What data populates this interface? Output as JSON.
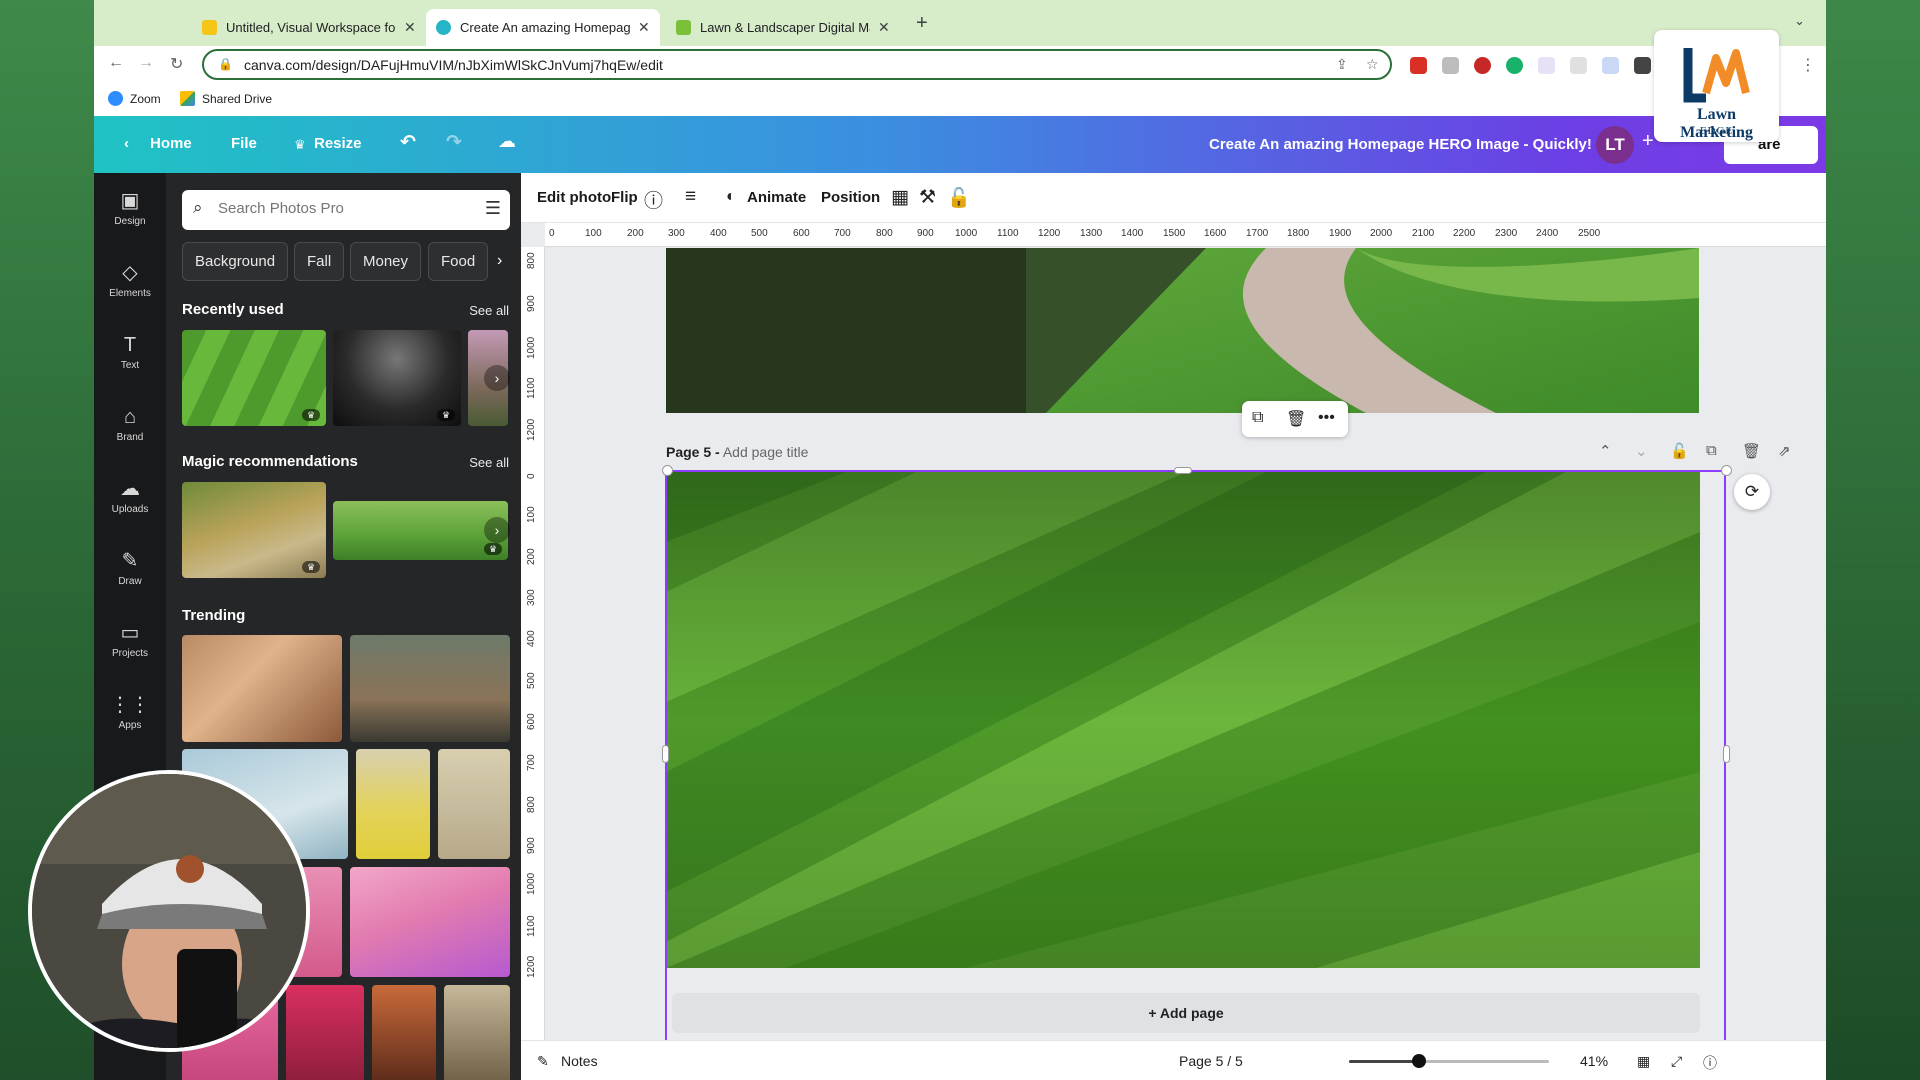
{
  "browser": {
    "tabs": [
      {
        "title": "Untitled, Visual Workspace for",
        "active": false
      },
      {
        "title": "Create An amazing Homepage",
        "active": true
      },
      {
        "title": "Lawn & Landscaper Digital Ma",
        "active": false
      }
    ],
    "url": "canva.com/design/DAFujHmuVIM/nJbXimWlSkCJnVumj7hqEw/edit",
    "bookmarks": [
      {
        "label": "Zoom"
      },
      {
        "label": "Shared Drive"
      }
    ]
  },
  "header": {
    "home": "Home",
    "file": "File",
    "resize": "Resize",
    "doc_title": "Create An amazing Homepage HERO Image - Quickly!",
    "avatar": "LT",
    "share": "are"
  },
  "logo": {
    "line1": "Lawn Marketing",
    "line2": "EDGE"
  },
  "rail": {
    "items": [
      {
        "label": "Design",
        "icon": "design-icon",
        "glyph": "▣"
      },
      {
        "label": "Elements",
        "icon": "elements-icon",
        "glyph": "◇"
      },
      {
        "label": "Text",
        "icon": "text-icon",
        "glyph": "T"
      },
      {
        "label": "Brand",
        "icon": "brand-icon",
        "glyph": "⌂"
      },
      {
        "label": "Uploads",
        "icon": "uploads-icon",
        "glyph": "☁"
      },
      {
        "label": "Draw",
        "icon": "draw-icon",
        "glyph": "✎"
      },
      {
        "label": "Projects",
        "icon": "projects-icon",
        "glyph": "▭"
      },
      {
        "label": "Apps",
        "icon": "apps-icon",
        "glyph": "⋮⋮"
      }
    ]
  },
  "panel": {
    "search_placeholder": "Search Photos Pro",
    "chips": [
      "Background",
      "Fall",
      "Money",
      "Food"
    ],
    "recently_used": "Recently used",
    "magic_recommendations": "Magic recommendations",
    "see_all": "See all",
    "trending": "Trending"
  },
  "editor": {
    "edit_photo": "Edit photo",
    "flip": "Flip",
    "animate": "Animate",
    "position": "Position",
    "ruler_h": [
      "0",
      "100",
      "200",
      "300",
      "400",
      "500",
      "600",
      "700",
      "800",
      "900",
      "1000",
      "1100",
      "1200",
      "1300",
      "1400",
      "1500",
      "1600",
      "1700",
      "1800",
      "1900",
      "2000",
      "2100",
      "2200",
      "2300",
      "2400",
      "2500"
    ],
    "ruler_v_top": [
      "800",
      "900",
      "1000",
      "1100",
      "1200"
    ],
    "ruler_v_bottom": [
      "0",
      "100",
      "200",
      "300",
      "400",
      "500",
      "600",
      "700",
      "800",
      "900",
      "1000",
      "1100",
      "1200"
    ],
    "page_label": "Page 5 -",
    "page_title_placeholder": "Add page title",
    "add_page": "+ Add page"
  },
  "footer": {
    "notes": "Notes",
    "page_indicator": "Page 5 / 5",
    "zoom": "41%",
    "zoom_value": 41
  }
}
